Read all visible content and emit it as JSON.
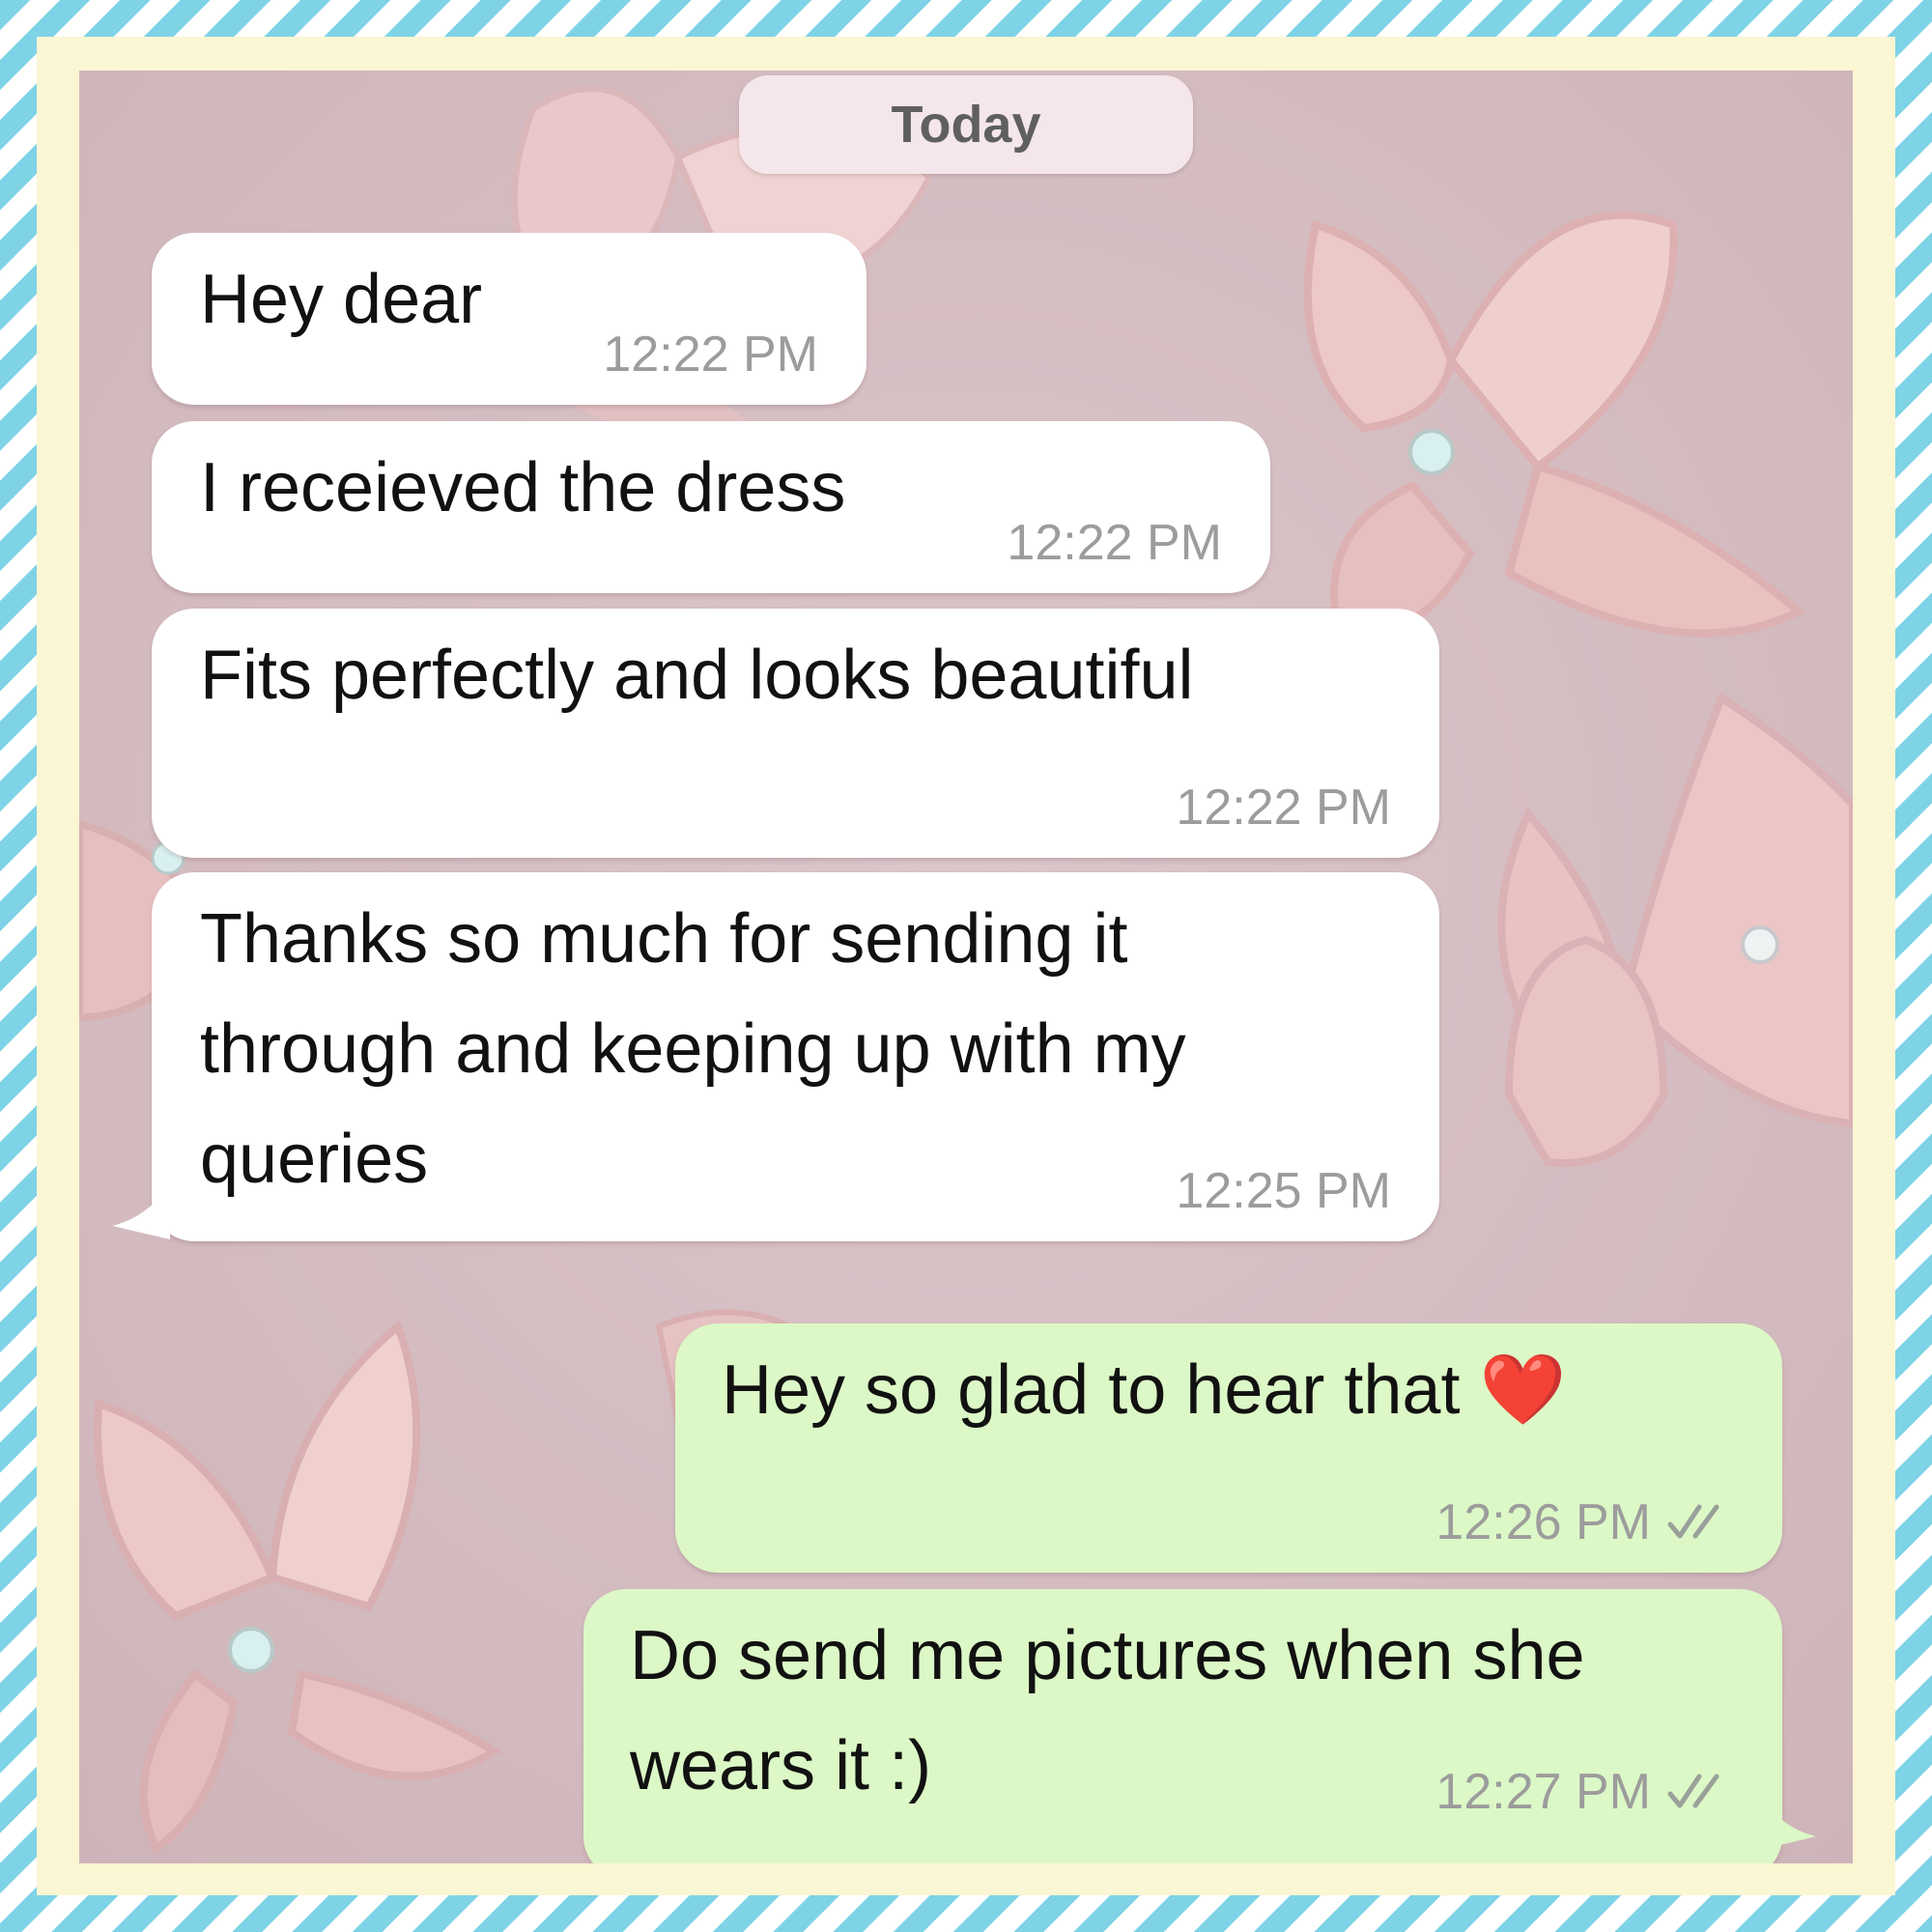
{
  "chat": {
    "date_label": "Today",
    "messages": [
      {
        "direction": "incoming",
        "text": "Hey dear",
        "time": "12:22 PM"
      },
      {
        "direction": "incoming",
        "text": "I receieved the dress",
        "time": "12:22 PM"
      },
      {
        "direction": "incoming",
        "text": "Fits perfectly and looks beautiful",
        "time": "12:22 PM"
      },
      {
        "direction": "incoming",
        "text": "Thanks so much for sending it\nthrough and keeping up with my\nqueries",
        "time": "12:25 PM"
      },
      {
        "direction": "outgoing",
        "text": "Hey so glad to hear that ❤️",
        "time": "12:26 PM",
        "status_icon": "double-check-icon"
      },
      {
        "direction": "outgoing",
        "text": "Do send me pictures when she\nwears it :)",
        "time": "12:27 PM",
        "status_icon": "double-check-icon"
      }
    ]
  },
  "colors": {
    "incoming_bubble": "#ffffff",
    "outgoing_bubble": "#dcf8c6",
    "timestamp": "#9c9c9c",
    "frame_stripe": "#7fd3e6",
    "frame_inner": "#fbf6d4",
    "wallpaper": "#d8c0c4"
  }
}
